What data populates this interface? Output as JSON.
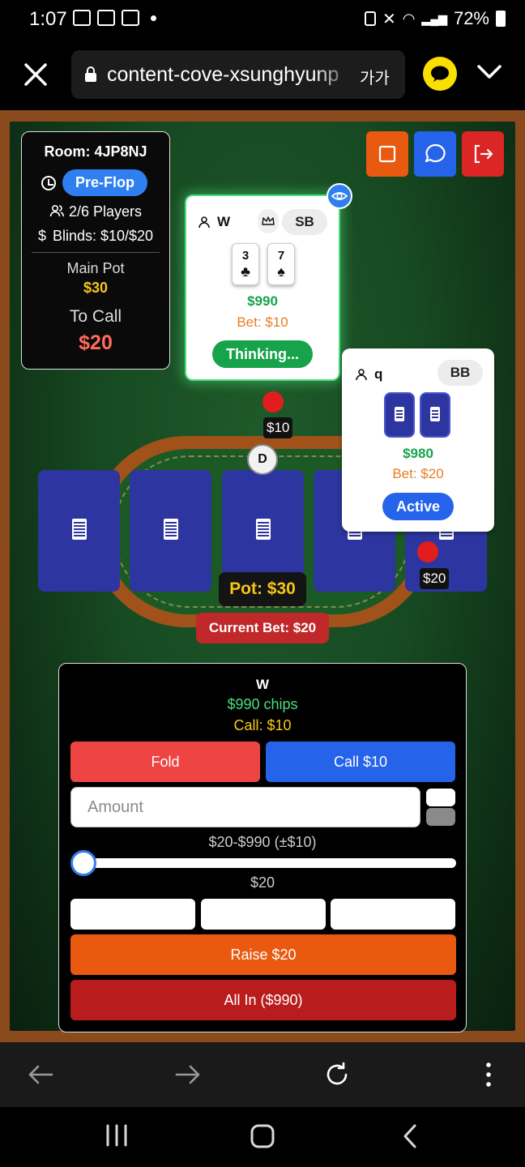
{
  "status_bar": {
    "time": "1:07",
    "battery": "72%"
  },
  "browser": {
    "url": "content-cove-xsunghyunp",
    "text_size_label": "가가"
  },
  "game": {
    "room": "Room: 4JP8NJ",
    "phase": "Pre-Flop",
    "players": "2/6 Players",
    "blinds": "Blinds: $10/$20",
    "main_pot_label": "Main Pot",
    "main_pot_value": "$30",
    "to_call_label": "To Call",
    "to_call_value": "$20",
    "dealer_label": "D",
    "pot": "Pot: $30",
    "current_bet": "Current Bet: $20"
  },
  "seats": {
    "w": {
      "name": "W",
      "blind": "SB",
      "cards": [
        {
          "rank": "3",
          "suit": "♣"
        },
        {
          "rank": "7",
          "suit": "♠"
        }
      ],
      "chips": "$990",
      "bet": "Bet: $10",
      "status": "Thinking...",
      "bet_chip": "$10"
    },
    "q": {
      "name": "q",
      "blind": "BB",
      "chips": "$980",
      "bet": "Bet: $20",
      "status": "Active",
      "bet_chip": "$20"
    }
  },
  "action_panel": {
    "player": "W",
    "chips": "$990 chips",
    "call_info": "Call: $10",
    "fold": "Fold",
    "call": "Call $10",
    "amount_placeholder": "Amount",
    "range": "$20-$990 (±$10)",
    "slider_value": "$20",
    "raise": "Raise $20",
    "all_in": "All In ($990)"
  },
  "colors": {
    "felt": "#174a22",
    "rail": "#a0521a",
    "primary_blue": "#2563eb",
    "fold_red": "#ef4444",
    "raise_orange": "#e9590f",
    "allin_red": "#b91c1c",
    "thinking_green": "#16a34a",
    "pot_gold": "#f5c518"
  }
}
